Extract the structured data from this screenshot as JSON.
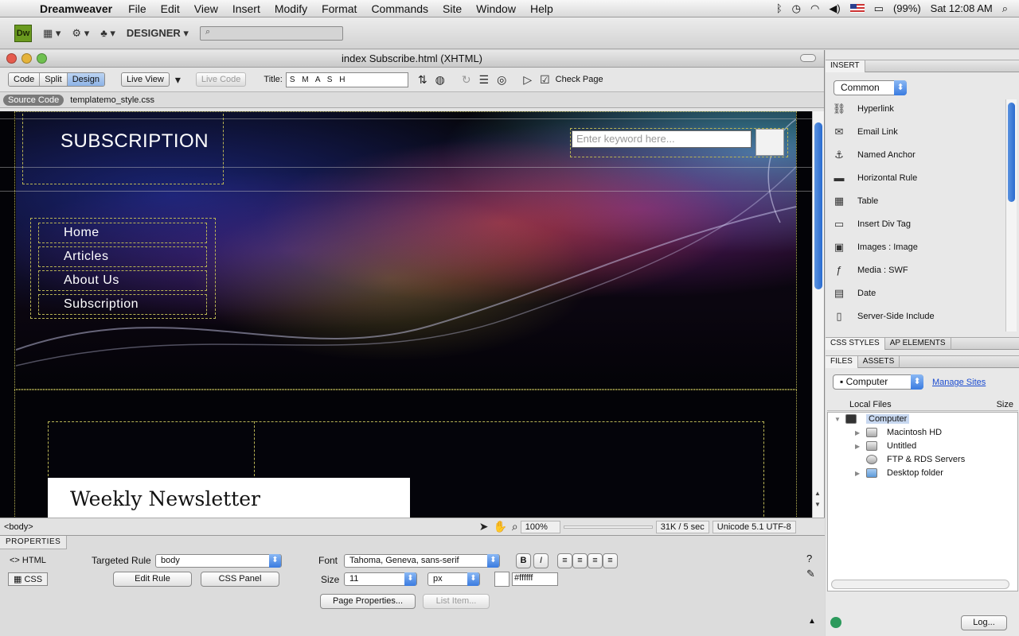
{
  "menubar": {
    "app_name": "Dreamweaver",
    "items": [
      "File",
      "Edit",
      "View",
      "Insert",
      "Modify",
      "Format",
      "Commands",
      "Site",
      "Window",
      "Help"
    ],
    "battery": "(99%)",
    "clock": "Sat 12:08 AM"
  },
  "app_toolbar": {
    "logo": "Dw",
    "workspace": "DESIGNER ▾",
    "search_placeholder": ""
  },
  "document": {
    "title": "index Subscribe.html (XHTML)",
    "views": [
      "Code",
      "Split",
      "Design"
    ],
    "live_view": "Live View",
    "live_code": "Live Code",
    "title_label": "Title:",
    "title_value": "S M A S H",
    "check_page": "Check Page",
    "related_files": [
      "Source Code",
      "templatemo_style.css"
    ]
  },
  "page": {
    "heading": "SUBSCRIPTION",
    "search_placeholder": "Enter keyword here...",
    "nav": [
      "Home",
      "Articles",
      "About Us",
      "Subscription"
    ],
    "newsletter_title": "Weekly Newsletter"
  },
  "statusbar": {
    "tag": "<body>",
    "zoom": "100%",
    "size": "31K / 5 sec",
    "encoding": "Unicode 5.1 UTF-8"
  },
  "properties": {
    "tab": "PROPERTIES",
    "html_label": "HTML",
    "css_label": "CSS",
    "targeted_rule_label": "Targeted Rule",
    "targeted_rule": "body",
    "edit_rule": "Edit Rule",
    "css_panel": "CSS Panel",
    "font_label": "Font",
    "font": "Tahoma, Geneva, sans-serif",
    "size_label": "Size",
    "size": "11",
    "unit": "px",
    "color": "#ffffff",
    "page_properties": "Page Properties...",
    "list_item": "List Item..."
  },
  "insert_panel": {
    "header": "INSERT",
    "category": "Common",
    "items": [
      "Hyperlink",
      "Email Link",
      "Named Anchor",
      "Horizontal Rule",
      "Table",
      "Insert Div Tag",
      "Images : Image",
      "Media : SWF",
      "Date",
      "Server-Side Include"
    ]
  },
  "css_panel": {
    "tabs": [
      "CSS STYLES",
      "AP ELEMENTS"
    ]
  },
  "files_panel": {
    "tabs": [
      "FILES",
      "ASSETS"
    ],
    "location": "Computer",
    "manage_sites": "Manage Sites",
    "col_local": "Local Files",
    "col_size": "Size",
    "tree": [
      "Computer",
      "Macintosh HD",
      "Untitled",
      "FTP & RDS Servers",
      "Desktop folder"
    ],
    "log_button": "Log..."
  }
}
